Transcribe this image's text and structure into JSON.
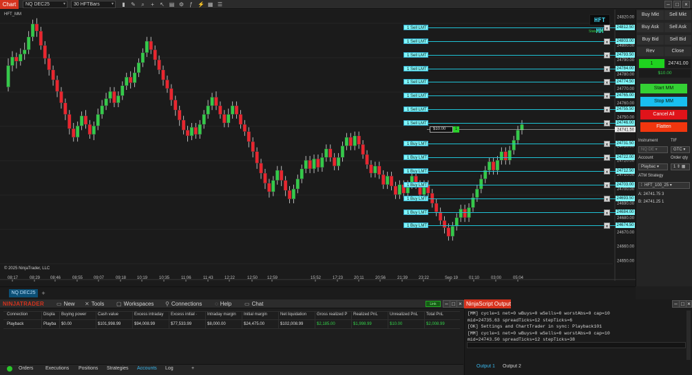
{
  "toolbar": {
    "tab_label": "Chart",
    "instrument": "NQ DEC25",
    "bar_type": "30 HFTBars"
  },
  "chart": {
    "label": "HFT_MM",
    "logo_text": "HFT MM",
    "status_text": "Status: M",
    "copyright": "© 2025 NinjaTrader, LLC",
    "current_price": "24741.50",
    "price_axis": [
      "24820.00",
      "24812.50",
      "24803.00",
      "24800.00",
      "24793.50",
      "24790.00",
      "24784.00",
      "24780.00",
      "24774.50",
      "24770.00",
      "24765.00",
      "24760.00",
      "24755.50",
      "24750.00",
      "24746.00",
      "24741.50",
      "24731.50",
      "24730.00",
      "24722.00",
      "24720.00",
      "24712.50",
      "24710.00",
      "24703.00",
      "24700.00",
      "24693.50",
      "24690.00",
      "24684.00",
      "24680.00",
      "24674.50",
      "24670.00",
      "24660.00",
      "24650.00"
    ],
    "time_axis": [
      "08:17",
      "08:29",
      "08:46",
      "08:55",
      "09:07",
      "09:18",
      "10:19",
      "10:35",
      "11:06",
      "11:43",
      "12:22",
      "12:50",
      "12:59",
      "15:52",
      "17:23",
      "20:11",
      "20:56",
      "21:39",
      "23:22",
      "Sep 19",
      "01:10",
      "03:00",
      "05:04"
    ],
    "candles": [
      [
        24771,
        24786,
        24768,
        24791
      ],
      [
        24786,
        24792,
        24782,
        24796
      ],
      [
        24792,
        24789,
        24784,
        24795
      ],
      [
        24789,
        24794,
        24786,
        24798
      ],
      [
        24794,
        24797,
        24790,
        24802
      ],
      [
        24797,
        24806,
        24794,
        24810
      ],
      [
        24806,
        24815,
        24803,
        24818
      ],
      [
        24815,
        24810,
        24806,
        24819
      ],
      [
        24810,
        24800,
        24797,
        24813
      ],
      [
        24800,
        24791,
        24787,
        24803
      ],
      [
        24791,
        24783,
        24779,
        24794
      ],
      [
        24783,
        24776,
        24772,
        24786
      ],
      [
        24776,
        24768,
        24764,
        24779
      ],
      [
        24768,
        24760,
        24756,
        24771
      ],
      [
        24760,
        24752,
        24748,
        24763
      ],
      [
        24752,
        24742,
        24738,
        24755
      ],
      [
        24742,
        24736,
        24733,
        24746
      ],
      [
        24736,
        24744,
        24733,
        24747
      ],
      [
        24744,
        24751,
        24741,
        24754
      ],
      [
        24751,
        24745,
        24742,
        24755
      ],
      [
        24745,
        24738,
        24735,
        24748
      ],
      [
        24738,
        24744,
        24734,
        24747
      ],
      [
        24744,
        24752,
        24741,
        24756
      ],
      [
        24752,
        24758,
        24749,
        24762
      ],
      [
        24758,
        24763,
        24755,
        24767
      ],
      [
        24763,
        24768,
        24760,
        24771
      ],
      [
        24768,
        24760,
        24757,
        24771
      ],
      [
        24760,
        24765,
        24757,
        24768
      ],
      [
        24765,
        24772,
        24762,
        24775
      ],
      [
        24772,
        24778,
        24769,
        24781
      ],
      [
        24778,
        24774,
        24770,
        24782
      ],
      [
        24774,
        24781,
        24771,
        24785
      ],
      [
        24781,
        24788,
        24778,
        24791
      ],
      [
        24788,
        24795,
        24785,
        24798
      ],
      [
        24795,
        24803,
        24792,
        24806
      ],
      [
        24803,
        24797,
        24794,
        24806
      ],
      [
        24797,
        24790,
        24786,
        24800
      ],
      [
        24790,
        24783,
        24780,
        24793
      ],
      [
        24783,
        24776,
        24772,
        24786
      ],
      [
        24776,
        24770,
        24767,
        24779
      ],
      [
        24770,
        24762,
        24758,
        24773
      ],
      [
        24762,
        24755,
        24751,
        24765
      ],
      [
        24755,
        24748,
        24744,
        24758
      ],
      [
        24748,
        24741,
        24738,
        24751
      ],
      [
        24741,
        24737,
        24733,
        24744
      ],
      [
        24737,
        24743,
        24734,
        24746
      ],
      [
        24743,
        24738,
        24735,
        24746
      ],
      [
        24738,
        24745,
        24735,
        24748
      ],
      [
        24745,
        24752,
        24742,
        24755
      ],
      [
        24752,
        24758,
        24749,
        24762
      ],
      [
        24758,
        24764,
        24755,
        24767
      ],
      [
        24764,
        24758,
        24755,
        24768
      ],
      [
        24758,
        24752,
        24749,
        24761
      ],
      [
        24752,
        24746,
        24743,
        24755
      ],
      [
        24746,
        24752,
        24743,
        24756
      ],
      [
        24752,
        24758,
        24749,
        24761
      ],
      [
        24758,
        24752,
        24749,
        24761
      ],
      [
        24752,
        24745,
        24742,
        24755
      ],
      [
        24745,
        24740,
        24737,
        24748
      ],
      [
        24740,
        24733,
        24729,
        24743
      ],
      [
        24733,
        24726,
        24722,
        24736
      ],
      [
        24726,
        24718,
        24714,
        24729
      ],
      [
        24718,
        24711,
        24707,
        24721
      ],
      [
        24711,
        24704,
        24700,
        24714
      ],
      [
        24704,
        24698,
        24694,
        24707
      ],
      [
        24698,
        24706,
        24695,
        24709
      ],
      [
        24706,
        24713,
        24703,
        24716
      ],
      [
        24713,
        24706,
        24702,
        24716
      ],
      [
        24706,
        24699,
        24695,
        24709
      ],
      [
        24699,
        24693,
        24690,
        24702
      ],
      [
        24693,
        24700,
        24690,
        24703
      ],
      [
        24700,
        24707,
        24697,
        24710
      ],
      [
        24707,
        24714,
        24704,
        24717
      ],
      [
        24714,
        24720,
        24711,
        24723
      ],
      [
        24720,
        24714,
        24711,
        24723
      ],
      [
        24714,
        24721,
        24711,
        24724
      ],
      [
        24721,
        24715,
        24712,
        24724
      ],
      [
        24715,
        24722,
        24712,
        24725
      ],
      [
        24722,
        24728,
        24719,
        24731
      ],
      [
        24728,
        24722,
        24719,
        24731
      ],
      [
        24722,
        24716,
        24713,
        24725
      ],
      [
        24716,
        24722,
        24713,
        24725
      ],
      [
        24722,
        24730,
        24719,
        24733
      ],
      [
        24730,
        24736,
        24727,
        24739
      ],
      [
        24736,
        24730,
        24727,
        24739
      ],
      [
        24730,
        24737,
        24727,
        24740
      ],
      [
        24737,
        24731,
        24728,
        24740
      ],
      [
        24731,
        24724,
        24721,
        24734
      ],
      [
        24724,
        24717,
        24714,
        24727
      ],
      [
        24717,
        24711,
        24708,
        24720
      ],
      [
        24711,
        24716,
        24708,
        24719
      ],
      [
        24716,
        24710,
        24707,
        24719
      ],
      [
        24710,
        24703,
        24700,
        24713
      ],
      [
        24703,
        24709,
        24700,
        24712
      ],
      [
        24709,
        24702,
        24699,
        24712
      ],
      [
        24702,
        24696,
        24693,
        24705
      ],
      [
        24696,
        24703,
        24693,
        24706
      ],
      [
        24703,
        24697,
        24694,
        24706
      ],
      [
        24697,
        24703,
        24694,
        24706
      ],
      [
        24703,
        24709,
        24700,
        24712
      ],
      [
        24709,
        24703,
        24700,
        24712
      ],
      [
        24703,
        24696,
        24693,
        24706
      ],
      [
        24696,
        24703,
        24693,
        24706
      ],
      [
        24703,
        24697,
        24694,
        24706
      ],
      [
        24697,
        24690,
        24687,
        24700
      ],
      [
        24690,
        24684,
        24681,
        24693
      ],
      [
        24684,
        24678,
        24675,
        24687
      ],
      [
        24678,
        24673,
        24669,
        24681
      ],
      [
        24673,
        24667,
        24664,
        24676
      ],
      [
        24667,
        24674,
        24664,
        24677
      ],
      [
        24674,
        24680,
        24671,
        24683
      ],
      [
        24680,
        24686,
        24677,
        24689
      ],
      [
        24686,
        24680,
        24677,
        24689
      ],
      [
        24680,
        24687,
        24677,
        24690
      ],
      [
        24687,
        24694,
        24684,
        24697
      ],
      [
        24694,
        24700,
        24691,
        24703
      ],
      [
        24700,
        24707,
        24697,
        24710
      ],
      [
        24707,
        24713,
        24704,
        24716
      ],
      [
        24713,
        24719,
        24710,
        24722
      ],
      [
        24719,
        24713,
        24710,
        24722
      ],
      [
        24713,
        24720,
        24710,
        24723
      ],
      [
        24720,
        24726,
        24717,
        24729
      ],
      [
        24726,
        24720,
        24717,
        24729
      ],
      [
        24720,
        24727,
        24717,
        24730
      ],
      [
        24727,
        24734,
        24724,
        24737
      ],
      [
        24734,
        24741,
        24731,
        24744
      ],
      [
        24741,
        24745,
        24738,
        24748
      ]
    ],
    "sell_orders": [
      {
        "label": "1  Sell LMT",
        "price": "24812.50"
      },
      {
        "label": "1  Sell LMT",
        "price": "24803.00"
      },
      {
        "label": "1  Sell LMT",
        "price": "24793.50"
      },
      {
        "label": "1  Sell LMT",
        "price": "24784.00"
      },
      {
        "label": "1  Sell LMT",
        "price": "24774.50"
      },
      {
        "label": "1  Sell LMT",
        "price": "24765.00"
      },
      {
        "label": "1  Sell LMT",
        "price": "24755.50"
      },
      {
        "label": "1  Sell LMT",
        "price": "24746.00"
      }
    ],
    "buy_orders": [
      {
        "label": "1  Buy LMT",
        "price": "24731.50"
      },
      {
        "label": "1  Buy LMT",
        "price": "24722.00"
      },
      {
        "label": "1  Buy LMT",
        "price": "24712.50"
      },
      {
        "label": "1  Buy LMT",
        "price": "24703.00"
      },
      {
        "label": "1  Buy LMT",
        "price": "24693.50"
      },
      {
        "label": "1  Buy LMT",
        "price": "24684.00"
      },
      {
        "label": "1  Buy LMT",
        "price": "24674.50"
      }
    ],
    "position_label": "$10.00",
    "position_qty": "1"
  },
  "right_panel": {
    "buy_mkt": "Buy Mkt",
    "sell_mkt": "Sell Mkt",
    "buy_ask": "Buy Ask",
    "sell_ask": "Sell Ask",
    "buy_bid": "Buy Bid",
    "sell_bid": "Sell Bid",
    "rev": "Rev",
    "close": "Close",
    "position": "1",
    "price": "24741.00",
    "pnl": "$10.00",
    "start_mm": "Start MM",
    "stop_mm": "Stop MM",
    "cancel_all": "Cancel All",
    "flatten": "Flatten",
    "instrument_label": "Instrument",
    "tif_label": "TIF",
    "instrument_value": "NQ DE",
    "tif_value": "GTC",
    "account_label": "Account",
    "order_qty_label": "Order qty",
    "account_value": "Playbac",
    "order_qty_value": "1",
    "atm_label": "ATM Strategy",
    "atm_value": "HFT_100_25",
    "ask_line": "A:  24741.75     3",
    "bid_line": "B:  24741.25     1"
  },
  "instrument_tab": "NQ DEC25",
  "control_center": {
    "logo": "NINJATRADER",
    "menu": [
      "New",
      "Tools",
      "Workspaces",
      "Connections",
      "Help",
      "Chat"
    ],
    "columns": [
      "Connection",
      "Displa",
      "Buying power",
      "Cash value",
      "Excess intraday",
      "Excess initial ·",
      "Intraday margin",
      "Initial margin",
      "Net liquidation",
      "Gross realized P",
      "Realized PnL",
      "Unrealized PnL",
      "Total PnL"
    ],
    "row": [
      "Playback",
      "Playba",
      "$0.00",
      "$101,998.99",
      "$94,008.99",
      "$77,533.99",
      "$8,000.00",
      "$24,475.00",
      "$102,008.99",
      "$2,185.00",
      "$1,998.99",
      "$10.00",
      "$2,008.99"
    ],
    "tabs": [
      "Orders",
      "Executions",
      "Positions",
      "Strategies",
      "Accounts",
      "Log"
    ],
    "active_tab": "Accounts",
    "link_label": "Link"
  },
  "output": {
    "title": "NinjaScript Output",
    "lines": [
      "[MM] cycle=1 net=0 wBuys=0 wSells=0 worstAbs=0 cap=10",
      "mid=24735.63 spreadTicks=12 stepTicks=6",
      "[OK] Settings and ChartTrader in sync: Playback101",
      "[MM] cycle=1 net=0 wBuys=0 wSells=0 worstAbs=0 cap=10",
      "mid=24743.50 spreadTicks=12 stepTicks=38"
    ],
    "tabs": [
      "Output 1",
      "Output 2"
    ]
  }
}
